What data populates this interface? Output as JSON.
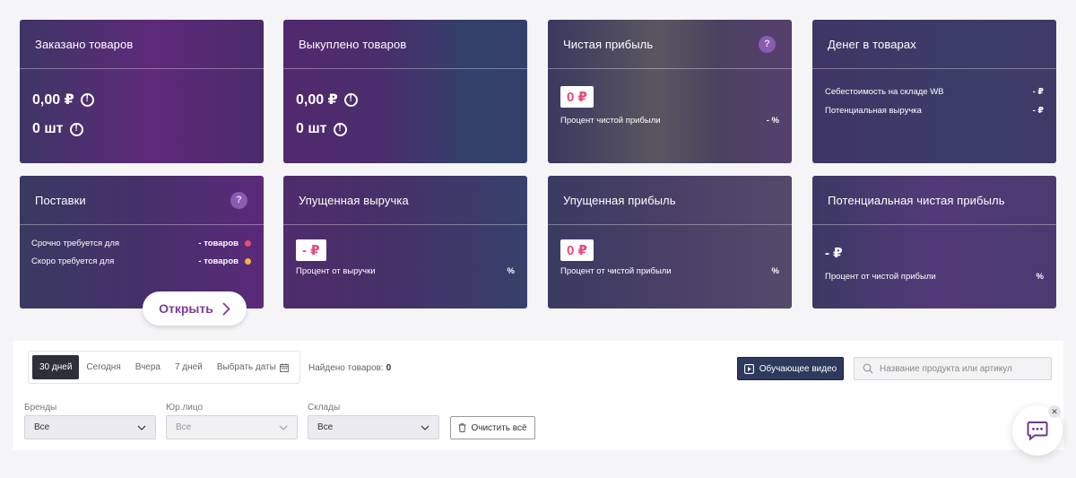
{
  "cards": {
    "ordered": {
      "title": "Заказано товаров",
      "amount": "0,00 ₽",
      "count": "0 шт",
      "warn_glyph": "!"
    },
    "bought": {
      "title": "Выкуплено товаров",
      "amount": "0,00 ₽",
      "count": "0 шт",
      "warn_glyph": "!"
    },
    "net_profit": {
      "title": "Чистая прибыль",
      "help": "?",
      "value": "0 ₽",
      "label": "Процент чистой прибыли",
      "pct": "- %"
    },
    "money": {
      "title": "Денег в товарах",
      "row1_label": "Себестоимость на складе WB",
      "row1_value": "- ₽",
      "row2_label": "Потенциальная выручка",
      "row2_value": "- ₽"
    },
    "supplies": {
      "title": "Поставки",
      "help": "?",
      "row1_label": "Срочно требуется для",
      "row1_value": "- товаров",
      "row2_label": "Скоро требуется для",
      "row2_value": "- товаров",
      "open_label": "Открыть"
    },
    "lost_revenue": {
      "title": "Упущенная выручка",
      "value": "- ₽",
      "label": "Процент от выручки",
      "pct": "%"
    },
    "lost_profit": {
      "title": "Упущенная прибыль",
      "value": "0 ₽",
      "label": "Процент от чистой прибыли",
      "pct": "%"
    },
    "potential_profit": {
      "title": "Потенциальная чистая прибыль",
      "value": "- ₽",
      "label": "Процент от чистой прибыли",
      "pct": "%"
    }
  },
  "filters": {
    "periods": [
      "30 дней",
      "Сегодня",
      "Вчера",
      "7 дней",
      "Выбрать даты"
    ],
    "found_label": "Найдено товаров:",
    "found_count": "0",
    "video_label": "Обучающее видео",
    "search_placeholder": "Название продукта или артикул",
    "brands_label": "Бренды",
    "brands_value": "Все",
    "legal_label": "Юр.лицо",
    "legal_value": "Все",
    "warehouses_label": "Склады",
    "warehouses_value": "Все",
    "clear_label": "Очистить всё"
  },
  "chat": {
    "close_glyph": "✕"
  },
  "colors": {
    "urgent_dot": "#e8506e",
    "soon_dot": "#f2b43a",
    "accent": "#7b3a9a",
    "dark_button": "#2d3a5d"
  }
}
